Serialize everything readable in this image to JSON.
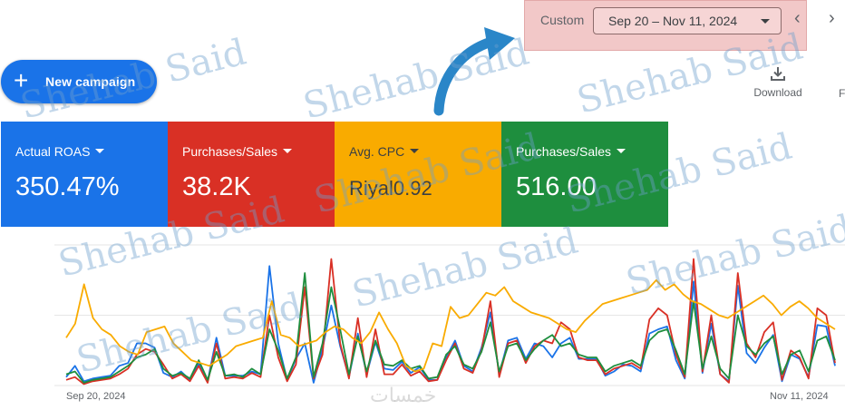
{
  "date_range": {
    "label": "Custom",
    "value": "Sep 20 – Nov 11, 2024"
  },
  "new_campaign": {
    "label": "New campaign"
  },
  "toolbar": {
    "download_label": "Download",
    "edge_label": "F"
  },
  "scorecards": [
    {
      "metric": "Actual ROAS",
      "value": "350.47%",
      "color": "#1a73e8"
    },
    {
      "metric": "Purchases/Sales",
      "value": "38.2K",
      "color": "#d93025"
    },
    {
      "metric": "Avg. CPC",
      "value": "Riyal0.92",
      "color": "#f9ab00"
    },
    {
      "metric": "Purchases/Sales",
      "value": "516.00",
      "color": "#1e8e3e"
    }
  ],
  "watermark": {
    "text": "Shehab Said",
    "logo": "خمسات"
  },
  "chart_data": {
    "type": "line",
    "x_start": "Sep 20, 2024",
    "x_end": "Nov 11, 2024",
    "grid": true,
    "ylim": [
      0,
      100
    ],
    "series": [
      {
        "color": "#1a73e8",
        "values": [
          6,
          14,
          3,
          5,
          6,
          7,
          14,
          16,
          30,
          30,
          27,
          9,
          6,
          10,
          4,
          16,
          3,
          34,
          7,
          7,
          7,
          10,
          8,
          85,
          30,
          4,
          19,
          30,
          2,
          26,
          57,
          28,
          6,
          37,
          8,
          31,
          12,
          11,
          17,
          9,
          13,
          4,
          4,
          20,
          32,
          14,
          10,
          27,
          52,
          8,
          32,
          34,
          19,
          30,
          28,
          20,
          30,
          34,
          19,
          19,
          19,
          7,
          10,
          15,
          14,
          10,
          37,
          40,
          42,
          18,
          5,
          74,
          9,
          44,
          8,
          3,
          71,
          23,
          16,
          27,
          36,
          3,
          22,
          19,
          6,
          43,
          42,
          14
        ]
      },
      {
        "color": "#d93025",
        "values": [
          4,
          6,
          1,
          3,
          4,
          5,
          8,
          12,
          22,
          26,
          24,
          15,
          5,
          8,
          3,
          14,
          2,
          30,
          5,
          6,
          5,
          9,
          6,
          50,
          20,
          3,
          15,
          70,
          5,
          22,
          90,
          30,
          5,
          48,
          6,
          40,
          8,
          8,
          15,
          7,
          10,
          3,
          4,
          18,
          30,
          12,
          9,
          25,
          60,
          6,
          30,
          32,
          16,
          28,
          32,
          30,
          45,
          40,
          20,
          18,
          18,
          8,
          12,
          14,
          16,
          12,
          47,
          55,
          50,
          22,
          6,
          90,
          10,
          50,
          8,
          2,
          80,
          30,
          20,
          38,
          45,
          4,
          25,
          20,
          5,
          55,
          50,
          16
        ]
      },
      {
        "color": "#1e8e3e",
        "values": [
          8,
          10,
          2,
          4,
          5,
          6,
          10,
          14,
          20,
          22,
          26,
          12,
          7,
          9,
          5,
          18,
          4,
          24,
          7,
          8,
          6,
          12,
          8,
          40,
          25,
          5,
          20,
          80,
          6,
          30,
          70,
          40,
          8,
          35,
          10,
          32,
          15,
          14,
          18,
          12,
          14,
          5,
          6,
          22,
          28,
          15,
          12,
          24,
          45,
          10,
          28,
          30,
          18,
          26,
          32,
          36,
          28,
          30,
          22,
          20,
          20,
          10,
          14,
          16,
          18,
          14,
          32,
          38,
          40,
          25,
          8,
          60,
          12,
          35,
          12,
          5,
          50,
          28,
          22,
          30,
          35,
          8,
          22,
          25,
          10,
          32,
          35,
          18
        ]
      },
      {
        "color": "#f9ab00",
        "values": [
          34,
          44,
          72,
          48,
          40,
          36,
          28,
          24,
          22,
          38,
          40,
          42,
          30,
          24,
          18,
          16,
          14,
          18,
          22,
          28,
          30,
          32,
          34,
          60,
          36,
          34,
          28,
          30,
          32,
          38,
          42,
          40,
          34,
          30,
          38,
          52,
          40,
          30,
          14,
          10,
          12,
          30,
          28,
          56,
          48,
          50,
          58,
          66,
          64,
          70,
          60,
          56,
          52,
          50,
          48,
          44,
          40,
          38,
          46,
          52,
          58,
          60,
          62,
          64,
          66,
          68,
          75,
          68,
          72,
          65,
          60,
          58,
          54,
          50,
          48,
          52,
          56,
          60,
          64,
          58,
          50,
          56,
          60,
          55,
          48,
          44,
          40
        ]
      }
    ]
  }
}
